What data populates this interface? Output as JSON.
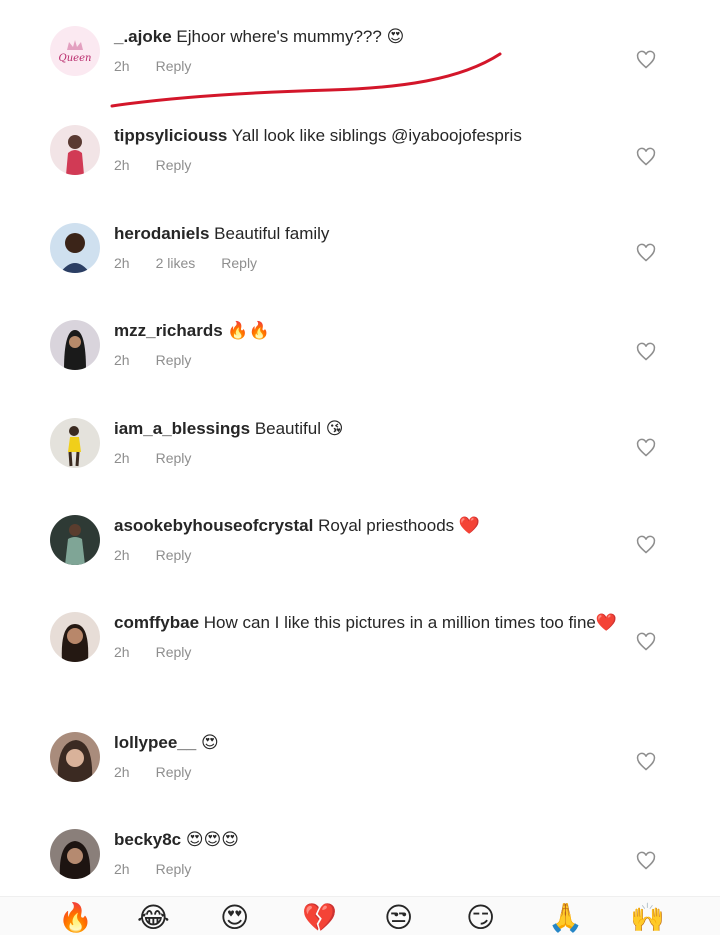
{
  "comments": [
    {
      "user": "_.ajoke",
      "text": "Ejhoor where's mummy???",
      "emoji": "😍",
      "time": "2h",
      "likes": "",
      "reply": "Reply",
      "avatar_badge": "Queen"
    },
    {
      "user": "tippsyliciouss",
      "text": "Yall look like siblings @iyaboojofespris",
      "emoji": "",
      "time": "2h",
      "likes": "",
      "reply": "Reply"
    },
    {
      "user": "herodaniels",
      "text": "Beautiful family",
      "emoji": "",
      "time": "2h",
      "likes": "2 likes",
      "reply": "Reply"
    },
    {
      "user": "mzz_richards",
      "text": "",
      "emoji": "🔥🔥",
      "time": "2h",
      "likes": "",
      "reply": "Reply"
    },
    {
      "user": "iam_a_blessings",
      "text": "Beautiful",
      "emoji": "😘",
      "time": "2h",
      "likes": "",
      "reply": "Reply"
    },
    {
      "user": "asookebyhouseofcrystal",
      "text": "Royal priesthoods",
      "emoji": "❤️",
      "time": "2h",
      "likes": "",
      "reply": "Reply"
    },
    {
      "user": "comffybae",
      "text": "How can I like this pictures in a million times  too fine",
      "emoji": "❤️",
      "time": "2h",
      "likes": "",
      "reply": "Reply"
    },
    {
      "user": "lollypee__",
      "text": "",
      "emoji": "😍",
      "time": "2h",
      "likes": "",
      "reply": "Reply"
    },
    {
      "user": "becky8c",
      "text": "",
      "emoji": "😍😍😍",
      "time": "2h",
      "likes": "",
      "reply": "Reply"
    }
  ],
  "quick_emojis": [
    "🔥",
    "😂",
    "😍",
    "💔",
    "😒",
    "😏",
    "🙏",
    "🙌"
  ],
  "colors": {
    "annotation": "#d3162a",
    "meta": "#8e8e8e",
    "text": "#262626"
  }
}
